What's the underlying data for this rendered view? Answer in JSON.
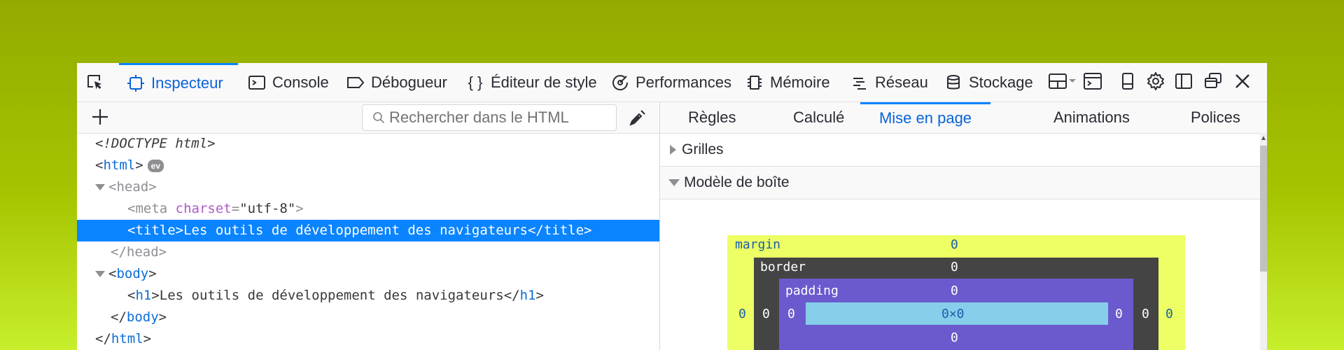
{
  "toolbar": {
    "tabs": [
      {
        "icon": "cursor-pick-icon",
        "label": ""
      },
      {
        "icon": "inspector-icon",
        "label": "Inspecteur"
      },
      {
        "icon": "console-icon",
        "label": "Console"
      },
      {
        "icon": "debugger-icon",
        "label": "Débogueur"
      },
      {
        "icon": "style-editor-icon",
        "label": "Éditeur de style"
      },
      {
        "icon": "performance-icon",
        "label": "Performances"
      },
      {
        "icon": "memory-icon",
        "label": "Mémoire"
      },
      {
        "icon": "network-icon",
        "label": "Réseau"
      },
      {
        "icon": "storage-icon",
        "label": "Stockage"
      }
    ],
    "buttons": [
      "layout-dock-icon",
      "split-console-icon",
      "responsive-design-icon",
      "settings-gear-icon",
      "dock-side-icon",
      "undock-window-icon",
      "close-icon"
    ]
  },
  "markup": {
    "search_placeholder": "Rechercher dans le HTML",
    "doctype": "<!DOCTYPE html>",
    "html_tag": "html",
    "ev_badge": "ev",
    "head_tag": "head",
    "meta_tag": "meta",
    "meta_attr": "charset",
    "meta_value": "\"utf-8\"",
    "title_text": "<title>Les outils de développement des navigateurs</title>",
    "h1_text": "Les outils de développement des navigateurs",
    "h1_tag": "h1",
    "body_tag": "body"
  },
  "sidebar": {
    "tabs": [
      "Règles",
      "Calculé",
      "Mise en page",
      "Animations",
      "Polices"
    ],
    "active_tab": "Mise en page",
    "sections": {
      "grids": "Grilles",
      "box_model": "Modèle de boîte"
    },
    "box": {
      "margin_label": "margin",
      "border_label": "border",
      "padding_label": "padding",
      "margin_top": "0",
      "border_top": "0",
      "padding_top": "0",
      "content_size": "0×0",
      "padding_bottom": "0",
      "left_values": [
        "0",
        "0",
        "0"
      ],
      "right_values": [
        "0",
        "0",
        "0"
      ]
    }
  },
  "colors": {
    "accent": "#0a84ff",
    "selection": "#0a84ff",
    "margin": "#edff64",
    "border": "#444444",
    "padding": "#6a5acd",
    "content": "#87ceeb"
  }
}
